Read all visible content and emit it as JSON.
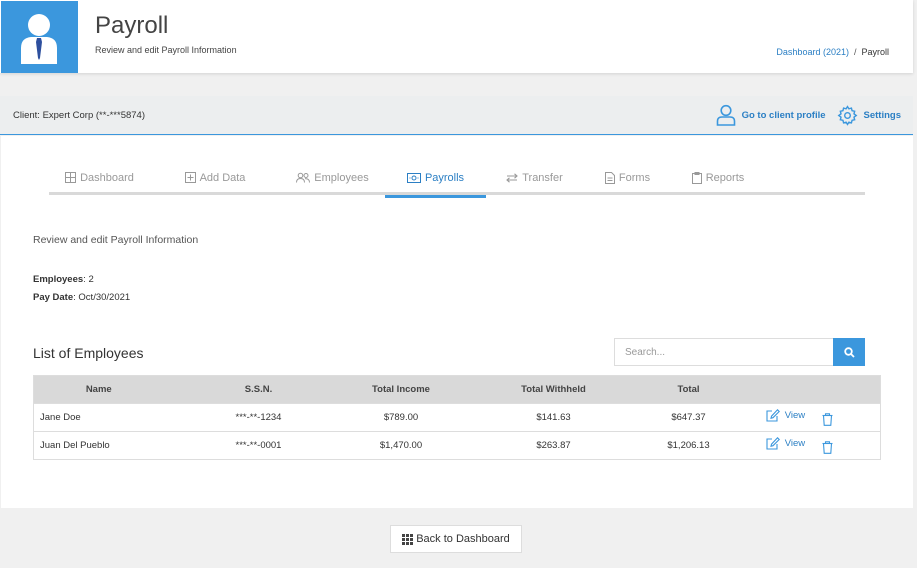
{
  "header": {
    "title": "Payroll",
    "subtitle": "Review and edit Payroll Information",
    "breadcrumb": {
      "link": "Dashboard (2021)",
      "separator": "/",
      "current": "Payroll"
    }
  },
  "client_bar": {
    "label": "Client: Expert Corp (**-***5874)",
    "profile_link": "Go to client profile",
    "settings_link": "Settings"
  },
  "tabs": [
    {
      "label": "Dashboard",
      "icon": "grid-icon"
    },
    {
      "label": "Add Data",
      "icon": "plus-square-icon"
    },
    {
      "label": "Employees",
      "icon": "users-icon"
    },
    {
      "label": "Payrolls",
      "icon": "money-icon",
      "active": true
    },
    {
      "label": "Transfer",
      "icon": "transfer-icon"
    },
    {
      "label": "Forms",
      "icon": "file-icon"
    },
    {
      "label": "Reports",
      "icon": "clipboard-icon"
    }
  ],
  "intro": "Review and edit Payroll Information",
  "meta": {
    "employees_label": "Employees",
    "employees_value": ": 2",
    "pay_date_label": "Pay Date",
    "pay_date_value": ": Oct/30/2021"
  },
  "list": {
    "title": "List of Employees",
    "search_placeholder": "Search...",
    "columns": [
      "Name",
      "S.S.N.",
      "Total Income",
      "Total Withheld",
      "Total",
      ""
    ],
    "rows": [
      {
        "name": "Jane Doe",
        "ssn": "***-**-1234",
        "income": "$789.00",
        "withheld": "$141.63",
        "total": "$647.37",
        "action": "View"
      },
      {
        "name": "Juan Del Pueblo",
        "ssn": "***-**-0001",
        "income": "$1,470.00",
        "withheld": "$263.87",
        "total": "$1,206.13",
        "action": "View"
      }
    ]
  },
  "footer": {
    "back_label": "Back to Dashboard"
  },
  "colors": {
    "accent": "#3b97dd",
    "link": "#2b7fc4",
    "header_gray": "#d9d9d9"
  }
}
